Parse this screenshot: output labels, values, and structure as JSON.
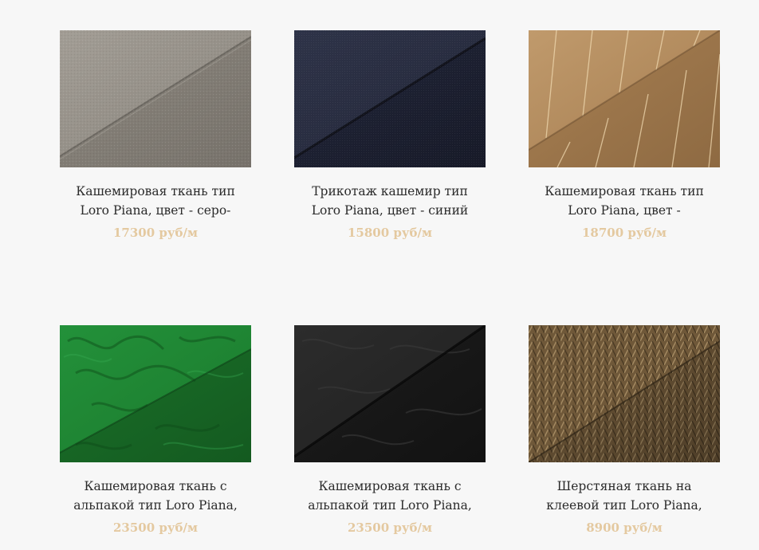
{
  "products": [
    {
      "title": "Кашемировая ткань тип Loro Piana, цвет - серо-",
      "price": "17300 руб/м",
      "fabric_color": "#8f8a83"
    },
    {
      "title": "Трикотаж кашемир тип Loro Piana, цвет - синий",
      "price": "15800 руб/м",
      "fabric_color": "#262a3d"
    },
    {
      "title": "Кашемировая ткань тип Loro Piana, цвет -",
      "price": "18700 руб/м",
      "fabric_color": "#b0875a"
    },
    {
      "title": "Кашемировая ткань с альпакой тип Loro Piana,",
      "price": "23500 руб/м",
      "fabric_color": "#1c7a2a"
    },
    {
      "title": "Кашемировая ткань с альпакой тип Loro Piana,",
      "price": "23500 руб/м",
      "fabric_color": "#1e1e1e"
    },
    {
      "title": "Шерстяная ткань на клеевой тип Loro Piana,",
      "price": "8900 руб/м",
      "fabric_color": "#7a6142"
    }
  ],
  "colors": {
    "price": "#e4c9a0",
    "title": "#2b2b2b",
    "background": "#f7f7f7"
  }
}
